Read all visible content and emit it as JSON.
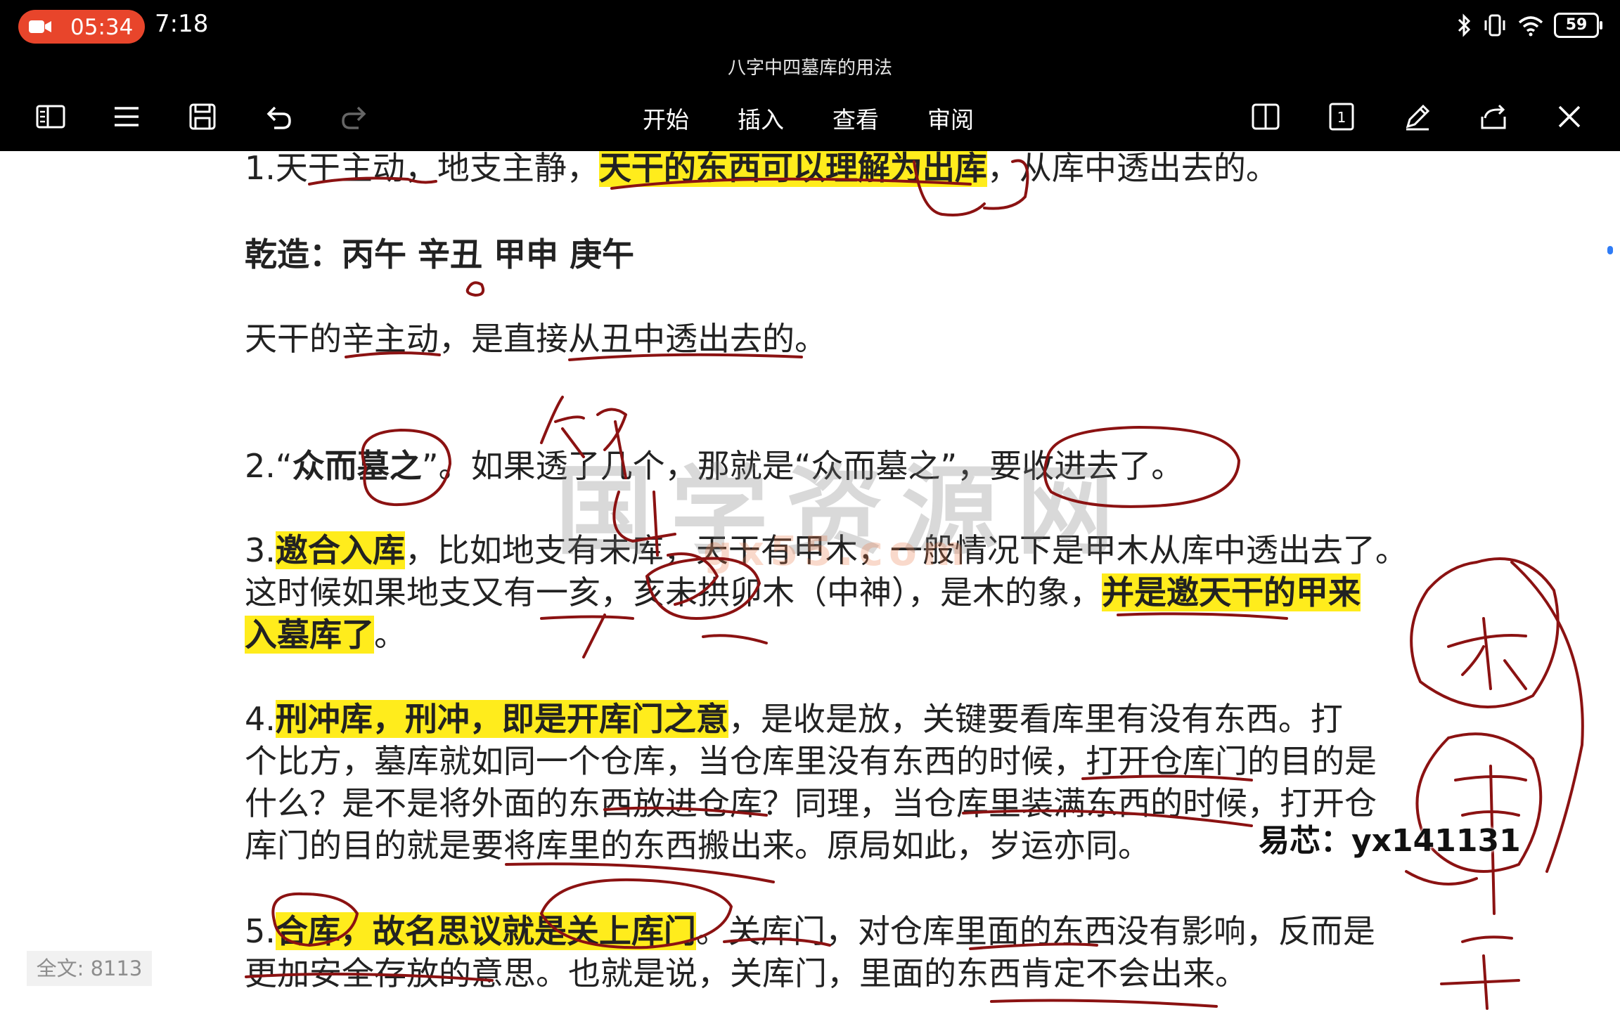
{
  "status_bar": {
    "recording_time": "05:34",
    "clock": "7:18",
    "battery": "59"
  },
  "document_title": "八字中四墓库的用法",
  "menu": {
    "tabs": [
      "开始",
      "插入",
      "查看",
      "审阅"
    ]
  },
  "content": {
    "l1_a": "1.天干主动，地支主静，",
    "l1_hl": "天干的东西可以理解为出库",
    "l1_b": "，从库中透出去的。",
    "qianzao": "乾造：丙午  辛丑  甲申  庚午",
    "l3": "天干的辛主动，是直接从丑中透出去的。",
    "l4_a": "2.“",
    "l4_bold": "众而墓之",
    "l4_b": "”。如果透了几个，那就是“众而墓之”，要收进去了。",
    "l5_a": "3.",
    "l5_hl": "邀合入库",
    "l5_b": "，比如地支有未库，天干有甲木，一般情况下是甲木从库中透出去了。",
    "l6_a": "这时候如果地支又有一亥，亥未拱卯木（中神），是木的象，",
    "l6_hl": "并是邀天干的甲来",
    "l7_hl": "入墓库了",
    "l7_b": "。",
    "l8_a": "4.",
    "l8_hl": "刑冲库，刑冲，即是开库门之意",
    "l8_b": "，是收是放，关键要看库里有没有东西。打",
    "l9": "个比方，墓库就如同一个仓库，当仓库里没有东西的时候，打开仓库门的目的是",
    "l10": "什么？是不是将外面的东西放进仓库？同理，当仓库里装满东西的时候，打开仓",
    "l11": "库门的目的就是要将库里的东西搬出来。原局如此，岁运亦同。",
    "l12_a": "5.",
    "l12_hl": "合库，故名思议就是关上库门",
    "l12_b": "。关库门，对仓库里面的东西没有影响，反而是",
    "l13": "更加安全存放的意思。也就是说，关库门，里面的东西肯定不会出来。"
  },
  "watermark": "国学资源网",
  "watermark_url": "gx55.com",
  "contact_overlay": "易芯：yx141131",
  "word_count": "全文: 8113",
  "ink_color": "#8b1212"
}
